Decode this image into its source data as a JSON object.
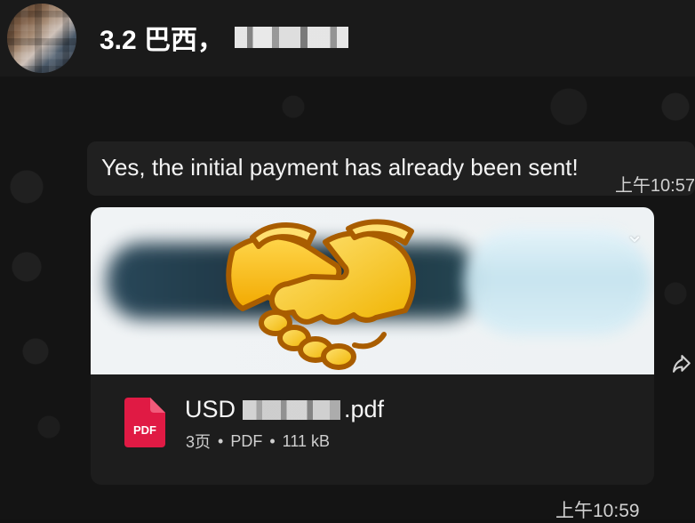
{
  "chat": {
    "title": "3.2 巴西，",
    "avatar": "contact-avatar"
  },
  "messages": [
    {
      "text": "Yes, the initial payment has already been sent!",
      "time": "上午10:57"
    }
  ],
  "attachment": {
    "file_name_prefix": "USD",
    "file_name_suffix": ".pdf",
    "icon_label": "PDF",
    "meta": {
      "pages": "3页",
      "type": "PDF",
      "size": "111 kB"
    },
    "time": "上午10:59"
  },
  "icons": {
    "expand": "chevron-down-icon",
    "forward": "forward-icon",
    "pdf": "pdf-file-icon",
    "emoji": "handshake-icon"
  }
}
